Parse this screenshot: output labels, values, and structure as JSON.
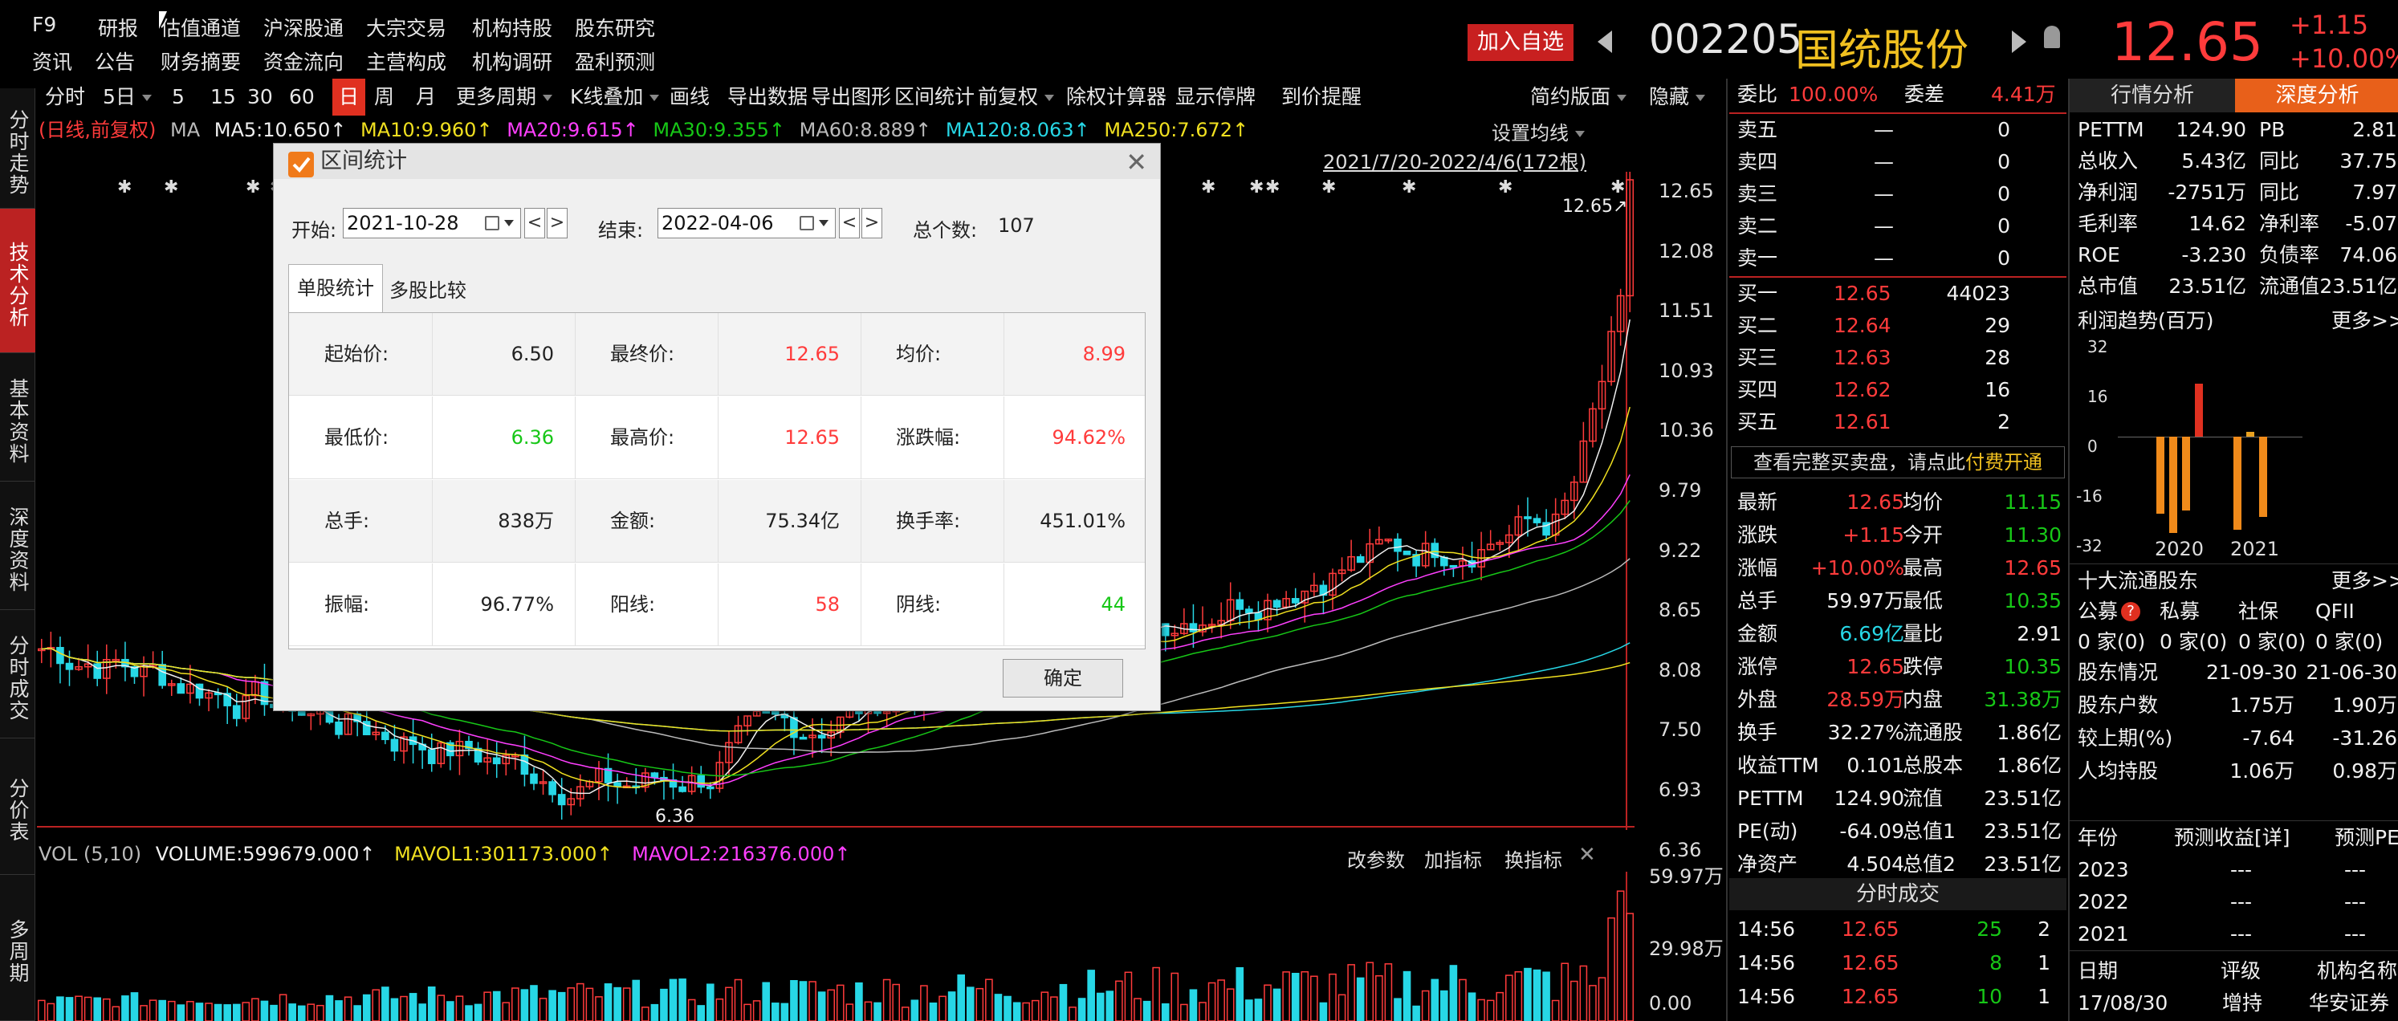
{
  "menu": {
    "row1": [
      "F9",
      "研报",
      "估值通道",
      "沪深股通",
      "大宗交易",
      "机构持股",
      "股东研究"
    ],
    "row2": [
      "资讯",
      "公告",
      "财务摘要",
      "资金流向",
      "主营构成",
      "机构调研",
      "盈利预测"
    ]
  },
  "header": {
    "add_watch": "加入自选",
    "code": "002205",
    "name": "国统股份",
    "price": "12.65",
    "change": "+1.15",
    "change_pct": "+10.00%"
  },
  "toolbar": {
    "items": [
      "分时",
      "5日",
      "5",
      "15",
      "30",
      "60",
      "日",
      "周",
      "月",
      "更多周期",
      "K线叠加",
      "画线",
      "导出数据",
      "导出图形",
      "区间统计",
      "前复权",
      "除权计算器",
      "显示停牌",
      "到价提醒"
    ],
    "layout": "简约版面",
    "hide": "隐藏"
  },
  "ma_bar": {
    "mode": "(日线,前复权)",
    "ma": "MA",
    "ma5": "MA5:10.650↑",
    "ma10": "MA10:9.960↑",
    "ma20": "MA20:9.615↑",
    "ma30": "MA30:9.355↑",
    "ma60": "MA60:8.889↑",
    "ma120": "MA120:8.063↑",
    "ma250": "MA250:7.672↑",
    "set_ma": "设置均线",
    "range": "2021/7/20-2022/4/6(172根)"
  },
  "leftnav": [
    "分时走势",
    "技术分析",
    "基本资料",
    "深度资料",
    "分时成交",
    "分价表",
    "多周期"
  ],
  "price_axis": [
    "12.65",
    "12.08",
    "11.51",
    "10.93",
    "10.36",
    "9.79",
    "9.22",
    "8.65",
    "8.08",
    "7.50",
    "6.93",
    "6.36"
  ],
  "chart_labels": {
    "high_label": "12.65↗",
    "low_label": "6.36"
  },
  "volume_bar": {
    "vol": "VOL (5,10)",
    "volume": "VOLUME:599679.000↑",
    "mavol1": "MAVOL1:301173.000↑",
    "mavol2": "MAVOL2:216376.000↑",
    "change_param": "改参数",
    "add_indicator": "加指标",
    "switch_indicator": "换指标"
  },
  "volume_axis": [
    "59.97万",
    "29.98万",
    "0.00"
  ],
  "dialog": {
    "title": "区间统计",
    "start_label": "开始:",
    "start_value": "2021-10-28",
    "end_label": "结束:",
    "end_value": "2022-04-06",
    "count_label": "总个数:",
    "count_value": "107",
    "tab1": "单股统计",
    "tab2": "多股比较",
    "ok": "确定",
    "rows": [
      [
        [
          "起始价:",
          "6.50",
          "black"
        ],
        [
          "最终价:",
          "12.65",
          "red"
        ],
        [
          "均价:",
          "8.99",
          "red"
        ]
      ],
      [
        [
          "最低价:",
          "6.36",
          "green"
        ],
        [
          "最高价:",
          "12.65",
          "red"
        ],
        [
          "涨跌幅:",
          "94.62%",
          "red"
        ]
      ],
      [
        [
          "总手:",
          "838万",
          "black"
        ],
        [
          "金额:",
          "75.34亿",
          "black"
        ],
        [
          "换手率:",
          "451.01%",
          "black"
        ]
      ],
      [
        [
          "振幅:",
          "96.77%",
          "black"
        ],
        [
          "阳线:",
          "58",
          "red"
        ],
        [
          "阴线:",
          "44",
          "green"
        ]
      ]
    ]
  },
  "orderbook": {
    "webi_label": "委比",
    "webi_value": "100.00%",
    "weicha_label": "委差",
    "weicha_value": "4.41万",
    "asks": [
      [
        "卖五",
        "—",
        "0"
      ],
      [
        "卖四",
        "—",
        "0"
      ],
      [
        "卖三",
        "—",
        "0"
      ],
      [
        "卖二",
        "—",
        "0"
      ],
      [
        "卖一",
        "—",
        "0"
      ]
    ],
    "bids": [
      [
        "买一",
        "12.65",
        "44023"
      ],
      [
        "买二",
        "12.64",
        "29"
      ],
      [
        "买三",
        "12.63",
        "28"
      ],
      [
        "买四",
        "12.62",
        "16"
      ],
      [
        "买五",
        "12.61",
        "2"
      ]
    ],
    "promo": "查看完整买卖盘，请点此",
    "promo_link": "付费开通"
  },
  "quote": [
    [
      [
        "最新",
        "12.65",
        "red"
      ],
      [
        "均价",
        "11.15",
        "green"
      ]
    ],
    [
      [
        "涨跌",
        "+1.15",
        "red"
      ],
      [
        "今开",
        "11.30",
        "green"
      ]
    ],
    [
      [
        "涨幅",
        "+10.00%",
        "red"
      ],
      [
        "最高",
        "12.65",
        "red"
      ]
    ],
    [
      [
        "总手",
        "59.97万",
        "white"
      ],
      [
        "最低",
        "10.35",
        "green"
      ]
    ],
    [
      [
        "金额",
        "6.69亿",
        "cyan"
      ],
      [
        "量比",
        "2.91",
        "white"
      ]
    ],
    [
      [
        "涨停",
        "12.65",
        "red"
      ],
      [
        "跌停",
        "10.35",
        "green"
      ]
    ],
    [
      [
        "外盘",
        "28.59万",
        "red"
      ],
      [
        "内盘",
        "31.38万",
        "green"
      ]
    ],
    [
      [
        "换手",
        "32.27%",
        "white"
      ],
      [
        "流通股",
        "1.86亿",
        "white"
      ]
    ],
    [
      [
        "收益TTM",
        "0.101",
        "white"
      ],
      [
        "总股本",
        "1.86亿",
        "white"
      ]
    ],
    [
      [
        "PETTM",
        "124.90",
        "white"
      ],
      [
        "流值",
        "23.51亿",
        "white"
      ]
    ],
    [
      [
        "PE(动)",
        "-64.09",
        "white"
      ],
      [
        "总值1",
        "23.51亿",
        "white"
      ]
    ],
    [
      [
        "净资产",
        "4.504",
        "white"
      ],
      [
        "总值2",
        "23.51亿",
        "white"
      ]
    ]
  ],
  "ticks": {
    "title": "分时成交",
    "rows": [
      [
        "14:56",
        "12.65",
        "25",
        "2"
      ],
      [
        "14:56",
        "12.65",
        "8",
        "1"
      ],
      [
        "14:56",
        "12.65",
        "10",
        "1"
      ]
    ]
  },
  "deep": {
    "tab1": "行情分析",
    "tab2": "深度分析",
    "metrics": [
      [
        [
          "PETTM",
          "124.90"
        ],
        [
          "PB",
          "2.81"
        ]
      ],
      [
        [
          "总收入",
          "5.43亿"
        ],
        [
          "同比",
          "37.75"
        ]
      ],
      [
        [
          "净利润",
          "-2751万"
        ],
        [
          "同比",
          "7.97"
        ]
      ],
      [
        [
          "毛利率",
          "14.62"
        ],
        [
          "净利率",
          "-5.07"
        ]
      ],
      [
        [
          "ROE",
          "-3.230"
        ],
        [
          "负债率",
          "74.06"
        ]
      ],
      [
        [
          "总市值",
          "23.51亿"
        ],
        [
          "流通值",
          "23.51亿"
        ]
      ]
    ],
    "profit_title": "利润趋势(百万)",
    "more": "更多>>",
    "profit_axis": [
      "32",
      "16",
      "0",
      "-16",
      "-32"
    ],
    "profit_years": [
      "2020",
      "2021"
    ],
    "holders_title": "十大流通股东",
    "holders_more": "更多>>",
    "holder_types": [
      "公募",
      "私募",
      "社保",
      "QFII"
    ],
    "holder_counts": [
      "0 家(0)",
      "0 家(0)",
      "0 家(0)",
      "0 家(0)"
    ],
    "holder_info": [
      [
        "股东情况",
        "21-09-30",
        "21-06-30"
      ],
      [
        "股东户数",
        "1.75万",
        "1.90万"
      ],
      [
        "较上期(%)",
        "-7.64",
        "-31.26"
      ],
      [
        "人均持股",
        "1.06万",
        "0.98万"
      ]
    ],
    "forecast_head": [
      "年份",
      "预测收益[详]",
      "预测PE"
    ],
    "forecast_rows": [
      [
        "2023",
        "---",
        "---"
      ],
      [
        "2022",
        "---",
        "---"
      ],
      [
        "2021",
        "---",
        "---"
      ]
    ],
    "rating_head": [
      "日期",
      "评级",
      "机构名称"
    ],
    "rating_rows": [
      [
        "17/08/30",
        "增持",
        "华安证券"
      ]
    ]
  },
  "chart_data": {
    "type": "candlestick",
    "range": "2021/7/20-2022/4/6(172根)",
    "price_min": 6.36,
    "price_max": 12.65,
    "last_close": 12.65,
    "ma5": 10.65,
    "ma10": 9.96,
    "ma20": 9.615,
    "ma30": 9.355,
    "ma60": 8.889,
    "ma120": 8.063,
    "ma250": 7.672,
    "volume": 599679,
    "mavol1": 301173,
    "mavol2": 216376
  }
}
